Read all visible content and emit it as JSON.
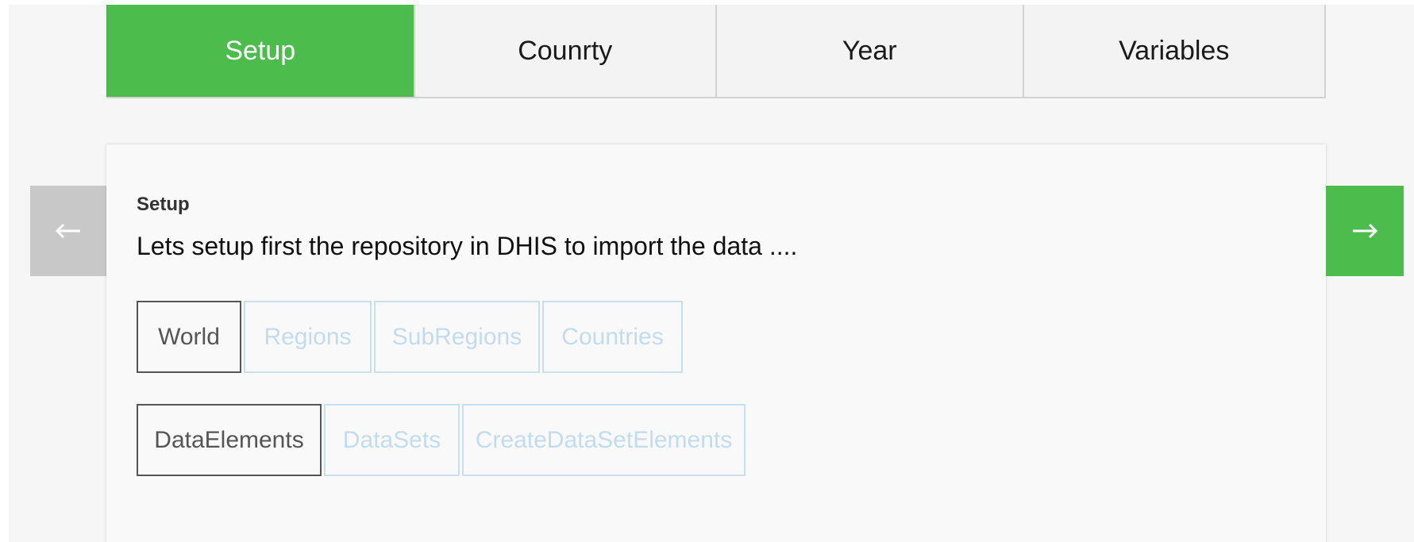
{
  "tabs": [
    {
      "label": "Setup",
      "active": true
    },
    {
      "label": "Counrty",
      "active": false
    },
    {
      "label": "Year",
      "active": false
    },
    {
      "label": "Variables",
      "active": false
    }
  ],
  "nav": {
    "prev_icon": "arrow-left-icon",
    "next_icon": "arrow-right-icon"
  },
  "card": {
    "title": "Setup",
    "description": "Lets setup first the repository in DHIS to import the data ....",
    "row1": [
      {
        "label": "World",
        "enabled": true
      },
      {
        "label": "Regions",
        "enabled": false
      },
      {
        "label": "SubRegions",
        "enabled": false
      },
      {
        "label": "Countries",
        "enabled": false
      }
    ],
    "row2": [
      {
        "label": "DataElements",
        "enabled": true
      },
      {
        "label": "DataSets",
        "enabled": false
      },
      {
        "label": "CreateDataSetElements",
        "enabled": false
      }
    ]
  },
  "colors": {
    "accent": "#4cbc4c",
    "disabled_border": "#c6e0f2",
    "disabled_text": "#c2dcef",
    "nav_prev_bg": "#c8c8c8"
  }
}
